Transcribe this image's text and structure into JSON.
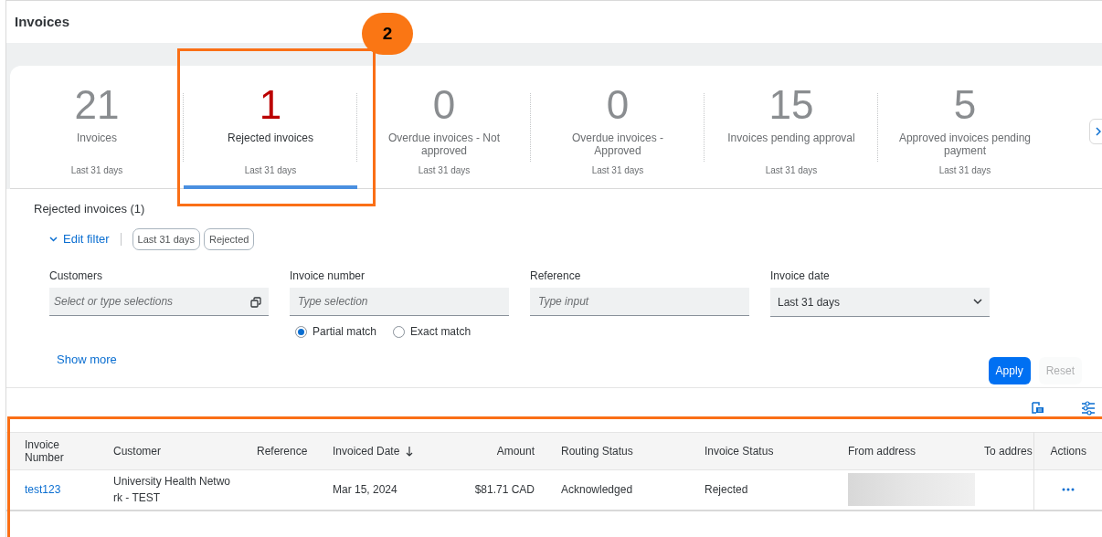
{
  "page": {
    "title": "Invoices"
  },
  "callout": {
    "number": "2"
  },
  "tiles": [
    {
      "value": "21",
      "label": "Invoices",
      "period": "Last 31 days",
      "kind": "neutral",
      "selected": false
    },
    {
      "value": "1",
      "label": "Rejected invoices",
      "period": "Last 31 days",
      "kind": "negative",
      "selected": true
    },
    {
      "value": "0",
      "label": "Overdue invoices - Not approved",
      "period": "Last 31 days",
      "kind": "neutral",
      "selected": false
    },
    {
      "value": "0",
      "label": "Overdue invoices - Approved",
      "period": "Last 31 days",
      "kind": "neutral",
      "selected": false
    },
    {
      "value": "15",
      "label": "Invoices pending approval",
      "period": "Last 31 days",
      "kind": "neutral",
      "selected": false
    },
    {
      "value": "5",
      "label": "Approved invoices pending payment",
      "period": "Last 31 days",
      "kind": "neutral",
      "selected": false
    }
  ],
  "filter": {
    "heading": "Rejected invoices (1)",
    "toggle": "Edit filter",
    "expanded": true,
    "chips": [
      "Last 31 days",
      "Rejected"
    ],
    "fields": [
      {
        "label": "Customers",
        "kind": "multi",
        "placeholder": "Select or type selections"
      },
      {
        "label": "Invoice number",
        "kind": "text",
        "placeholder": "Type selection"
      },
      {
        "label": "Reference",
        "kind": "text",
        "placeholder": "Type input"
      },
      {
        "label": "Invoice date",
        "kind": "select",
        "value": "Last 31 days"
      }
    ],
    "match_options": [
      {
        "label": "Partial match",
        "selected": true
      },
      {
        "label": "Exact match",
        "selected": false
      }
    ],
    "show_more": "Show more",
    "buttons": [
      {
        "label": "Apply",
        "kind": "primary",
        "disabled": false
      },
      {
        "label": "Reset",
        "kind": "secondary",
        "disabled": true
      }
    ]
  },
  "table": {
    "columns": [
      {
        "label": "Invoice Number",
        "sorted": false
      },
      {
        "label": "Customer",
        "sorted": false
      },
      {
        "label": "Reference",
        "sorted": false
      },
      {
        "label": "Invoiced Date",
        "sorted": true
      },
      {
        "label": "Amount",
        "sorted": false
      },
      {
        "label": "Routing Status",
        "sorted": false
      },
      {
        "label": "Invoice Status",
        "sorted": false
      },
      {
        "label": "From address",
        "sorted": false
      },
      {
        "label": "To addres",
        "sorted": false
      },
      {
        "label": "Actions",
        "sorted": false
      }
    ],
    "rows": [
      {
        "cells": [
          {
            "kind": "link",
            "text": "test123"
          },
          {
            "kind": "text",
            "text": "University Health Netwo rk - TEST"
          },
          {
            "kind": "empty"
          },
          {
            "kind": "text",
            "text": "Mar 15, 2024"
          },
          {
            "kind": "text",
            "text": "$81.71 CAD"
          },
          {
            "kind": "text",
            "text": "Acknowledged"
          },
          {
            "kind": "text",
            "text": "Rejected"
          },
          {
            "kind": "redacted"
          },
          {
            "kind": "empty"
          },
          {
            "kind": "actions"
          }
        ]
      }
    ]
  }
}
